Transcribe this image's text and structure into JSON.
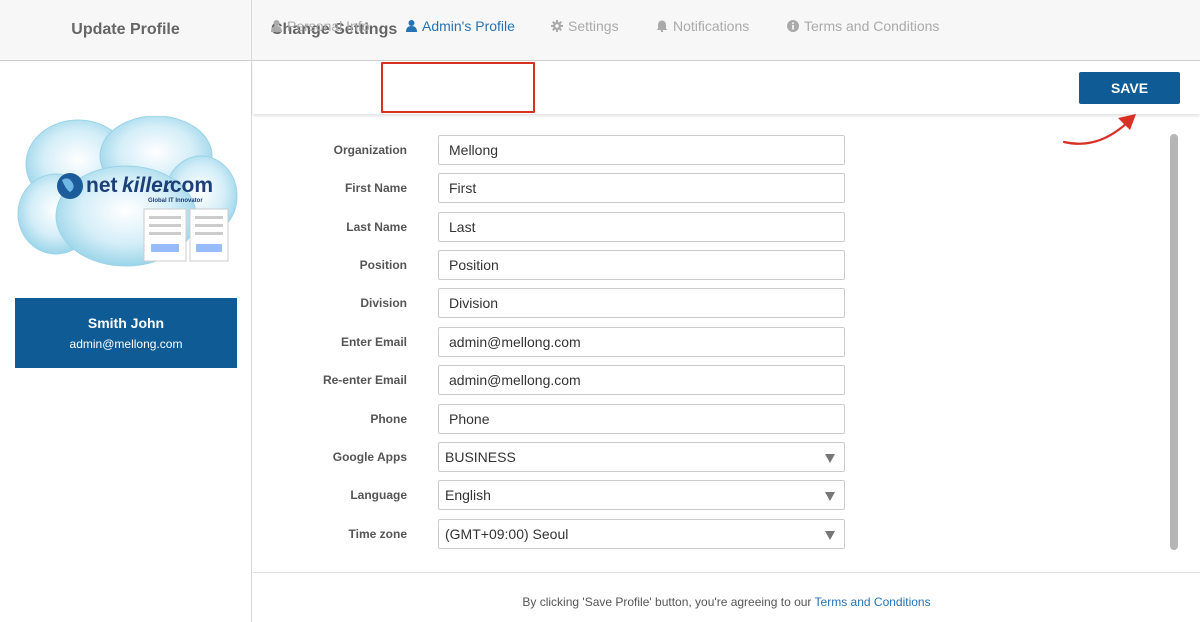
{
  "sidebar": {
    "title": "Update Profile",
    "logo": {
      "brand_net": "net",
      "brand_killer": "killer",
      "brand_com": ".com",
      "tagline": "Global IT Innovator"
    },
    "user": {
      "name": "Smith John",
      "email": "admin@mellong.com"
    }
  },
  "header": {
    "title": "Change Settings"
  },
  "tabs": [
    {
      "label": "Personal Info",
      "icon": "user-icon",
      "active": false
    },
    {
      "label": "Admin's Profile",
      "icon": "user-icon",
      "active": true
    },
    {
      "label": "Settings",
      "icon": "gear-icon",
      "active": false
    },
    {
      "label": "Notifications",
      "icon": "bell-icon",
      "active": false
    },
    {
      "label": "Terms and Conditions",
      "icon": "info-icon",
      "active": false
    }
  ],
  "toolbar": {
    "save_label": "SAVE"
  },
  "form": {
    "organization": {
      "label": "Organization",
      "value": "Mellong"
    },
    "first_name": {
      "label": "First Name",
      "value": "First"
    },
    "last_name": {
      "label": "Last Name",
      "value": "Last"
    },
    "position": {
      "label": "Position",
      "value": "Position"
    },
    "division": {
      "label": "Division",
      "value": "Division"
    },
    "email": {
      "label": "Enter Email",
      "value": "admin@mellong.com"
    },
    "reemail": {
      "label": "Re-enter Email",
      "value": "admin@mellong.com"
    },
    "phone": {
      "label": "Phone",
      "value": "Phone"
    },
    "google_apps": {
      "label": "Google Apps",
      "value": "BUSINESS"
    },
    "language": {
      "label": "Language",
      "value": "English"
    },
    "timezone": {
      "label": "Time zone",
      "value": "(GMT+09:00) Seoul"
    }
  },
  "footer": {
    "text": "By clicking 'Save Profile' button, you're agreeing to our ",
    "link": "Terms and Conditions"
  },
  "colors": {
    "primary": "#0f5b96",
    "link": "#2573b4",
    "highlight": "#d93025"
  }
}
